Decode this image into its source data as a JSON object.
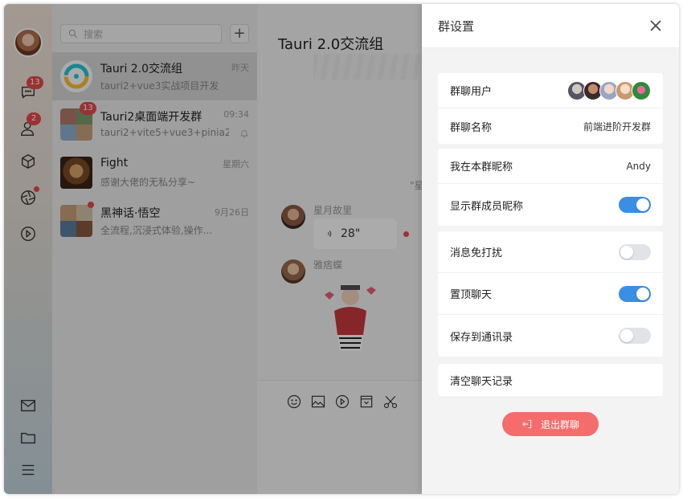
{
  "window": {
    "app": "Tauri 2.0 chat"
  },
  "rail": {
    "badges": {
      "chat": "13",
      "contacts": "2"
    },
    "icons": [
      "chat-icon",
      "contacts-icon",
      "cube-icon",
      "shutter-icon",
      "play-icon",
      "mail-icon",
      "folder-icon",
      "menu-icon"
    ]
  },
  "sessions": {
    "search_placeholder": "搜索",
    "add_label": "+",
    "items": [
      {
        "name": "Tauri 2.0交流组",
        "time": "昨天",
        "preview": "tauri2+vue3实战项目开发",
        "badge": "",
        "active": true
      },
      {
        "name": "Tauri2桌面端开发群",
        "time": "09:34",
        "preview": "tauri2+vite5+vue3+pinia2...",
        "badge": "13",
        "muted": true
      },
      {
        "name": "Fight",
        "time": "星期六",
        "preview": "感谢大佬的无私分享~",
        "badge": ""
      },
      {
        "name": "黑神话·悟空",
        "time": "9月26日",
        "preview": "全流程,沉浸式体验,操作...",
        "dot": true
      }
    ]
  },
  "chat": {
    "title": "Tauri 2.0交流组",
    "system_text": "\"星",
    "messages": [
      {
        "sender": "星月故里",
        "voice_duration": "28\""
      },
      {
        "sender": "雅痞蝶"
      }
    ]
  },
  "panel": {
    "title": "群设置",
    "rows": {
      "members_label": "群聊用户",
      "group_name_label": "群聊名称",
      "group_name_value": "前端进阶开发群",
      "nickname_label": "我在本群昵称",
      "nickname_value": "Andy",
      "show_nick_label": "显示群成员昵称",
      "show_nick_on": true,
      "dnd_label": "消息免打扰",
      "dnd_on": false,
      "pin_label": "置顶聊天",
      "pin_on": true,
      "save_label": "保存到通讯录",
      "save_on": false,
      "clear_label": "清空聊天记录"
    },
    "exit_label": "退出群聊"
  },
  "colors": {
    "accent": "#3a8ee6",
    "danger": "#f56c6c",
    "badge": "#e84a4a"
  }
}
